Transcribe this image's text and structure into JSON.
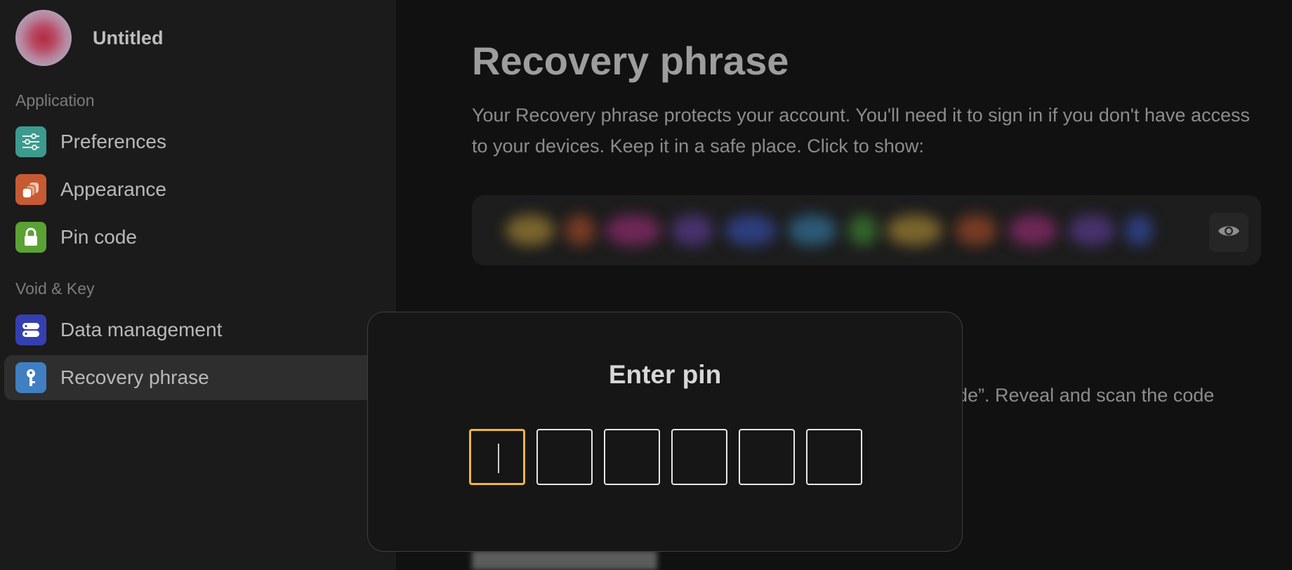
{
  "sidebar": {
    "profile": {
      "name": "Untitled"
    },
    "sections": [
      {
        "label": "Application"
      },
      {
        "label": "Void & Key"
      }
    ],
    "items": [
      {
        "label": "Preferences",
        "icon": "sliders-icon",
        "color": "#3d9a8e"
      },
      {
        "label": "Appearance",
        "icon": "layers-icon",
        "color": "#c65a33"
      },
      {
        "label": "Pin code",
        "icon": "lock-icon",
        "color": "#5aa233"
      },
      {
        "label": "Data management",
        "icon": "database-icon",
        "color": "#3540b0"
      },
      {
        "label": "Recovery phrase",
        "icon": "key-icon",
        "color": "#3f7fc2",
        "active": true
      }
    ]
  },
  "main": {
    "title": "Recovery phrase",
    "description": "Your Recovery phrase protects your account. You'll need it to sign in if you don't have access to your devices. Keep it in a safe place. Click to show:",
    "partial_text": "ode”. Reveal and scan the code",
    "reveal_icon": "eye-icon"
  },
  "modal": {
    "title": "Enter pin",
    "pin_length": 6,
    "accent": "#f0b541"
  }
}
